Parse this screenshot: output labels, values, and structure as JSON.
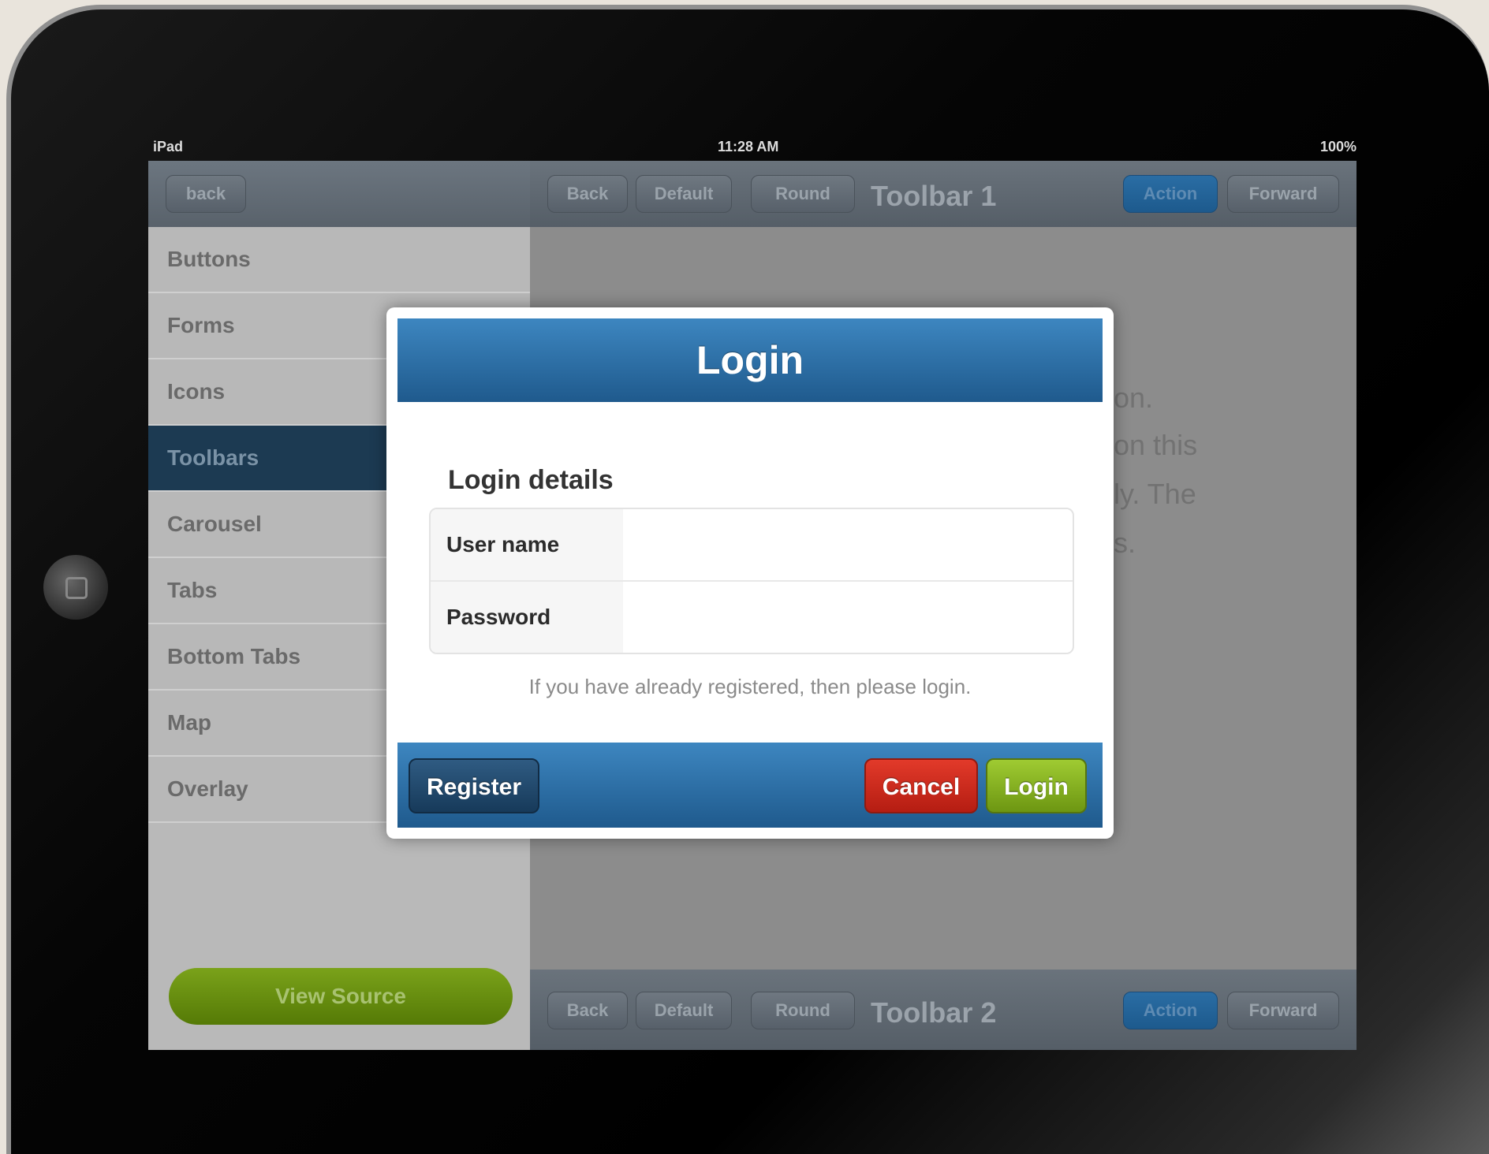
{
  "status_bar": {
    "left": "iPad",
    "time": "11:28 AM",
    "battery": "100%"
  },
  "sidebar": {
    "back_label": "back",
    "items": [
      {
        "label": "Buttons"
      },
      {
        "label": "Forms"
      },
      {
        "label": "Icons"
      },
      {
        "label": "Toolbars",
        "active": true
      },
      {
        "label": "Carousel"
      },
      {
        "label": "Tabs"
      },
      {
        "label": "Bottom Tabs"
      },
      {
        "label": "Map"
      },
      {
        "label": "Overlay"
      }
    ],
    "view_source_label": "View Source"
  },
  "toolbar1": {
    "buttons": [
      "Back",
      "Default",
      "Round"
    ],
    "title": "Toolbar 1",
    "action_label": "Action",
    "forward_label": "Forward"
  },
  "toolbar2": {
    "buttons": [
      "Back",
      "Default",
      "Round"
    ],
    "title": "Toolbar 2",
    "action_label": "Action",
    "forward_label": "Forward"
  },
  "background_text": [
    "on.",
    "on this",
    "ly. The",
    "s."
  ],
  "dialog": {
    "title": "Login",
    "section_title": "Login details",
    "username_label": "User name",
    "username_value": "",
    "password_label": "Password",
    "password_value": "",
    "hint": "If you have already registered, then please login.",
    "register_label": "Register",
    "cancel_label": "Cancel",
    "login_label": "Login"
  },
  "colors": {
    "dialog_blue": "#2a6ea6",
    "cancel_red": "#d12b1e",
    "login_green": "#86b022",
    "register_navy": "#1f4668"
  }
}
